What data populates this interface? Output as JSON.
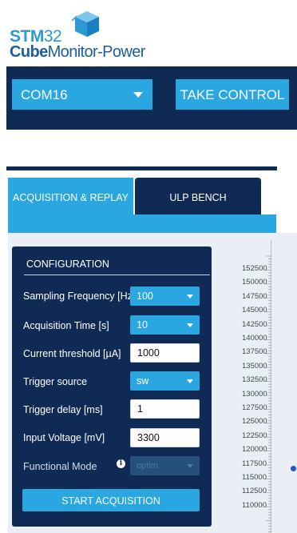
{
  "logo": {
    "brand": "STM",
    "number": "32",
    "cube": "Cube",
    "product": "Monitor-Power"
  },
  "topbar": {
    "port": "COM16",
    "take_control": "TAKE CONTROL"
  },
  "tabs": [
    {
      "label": "ACQUISITION & REPLAY",
      "active": true
    },
    {
      "label": "ULP BENCH",
      "active": false
    }
  ],
  "config": {
    "title": "CONFIGURATION",
    "sampling_frequency": {
      "label": "Sampling Frequency [Hz]",
      "value": "100"
    },
    "acquisition_time": {
      "label": "Acquisition Time [s]",
      "value": "10"
    },
    "current_threshold": {
      "label": "Current threshold [µA]",
      "value": "1000"
    },
    "trigger_source": {
      "label": "Trigger source",
      "value": "sw"
    },
    "trigger_delay": {
      "label": "Trigger delay [ms]",
      "value": "1"
    },
    "input_voltage": {
      "label": "Input Voltage [mV]",
      "value": "3300"
    },
    "functional_mode": {
      "label": "Functional Mode",
      "value": "optim",
      "info_icon": "info-icon"
    },
    "start_button": "START ACQUISITION"
  },
  "axis": {
    "ticks": [
      "152500",
      "150000",
      "147500",
      "145000",
      "142500",
      "140000",
      "137500",
      "135000",
      "132500",
      "130000",
      "127500",
      "125000",
      "122500",
      "120000",
      "117500",
      "115000",
      "112500",
      "110000"
    ]
  },
  "colors": {
    "navy": "#0f2a55",
    "accent": "#2aa6e0",
    "panel_bg": "#e9eff5"
  }
}
